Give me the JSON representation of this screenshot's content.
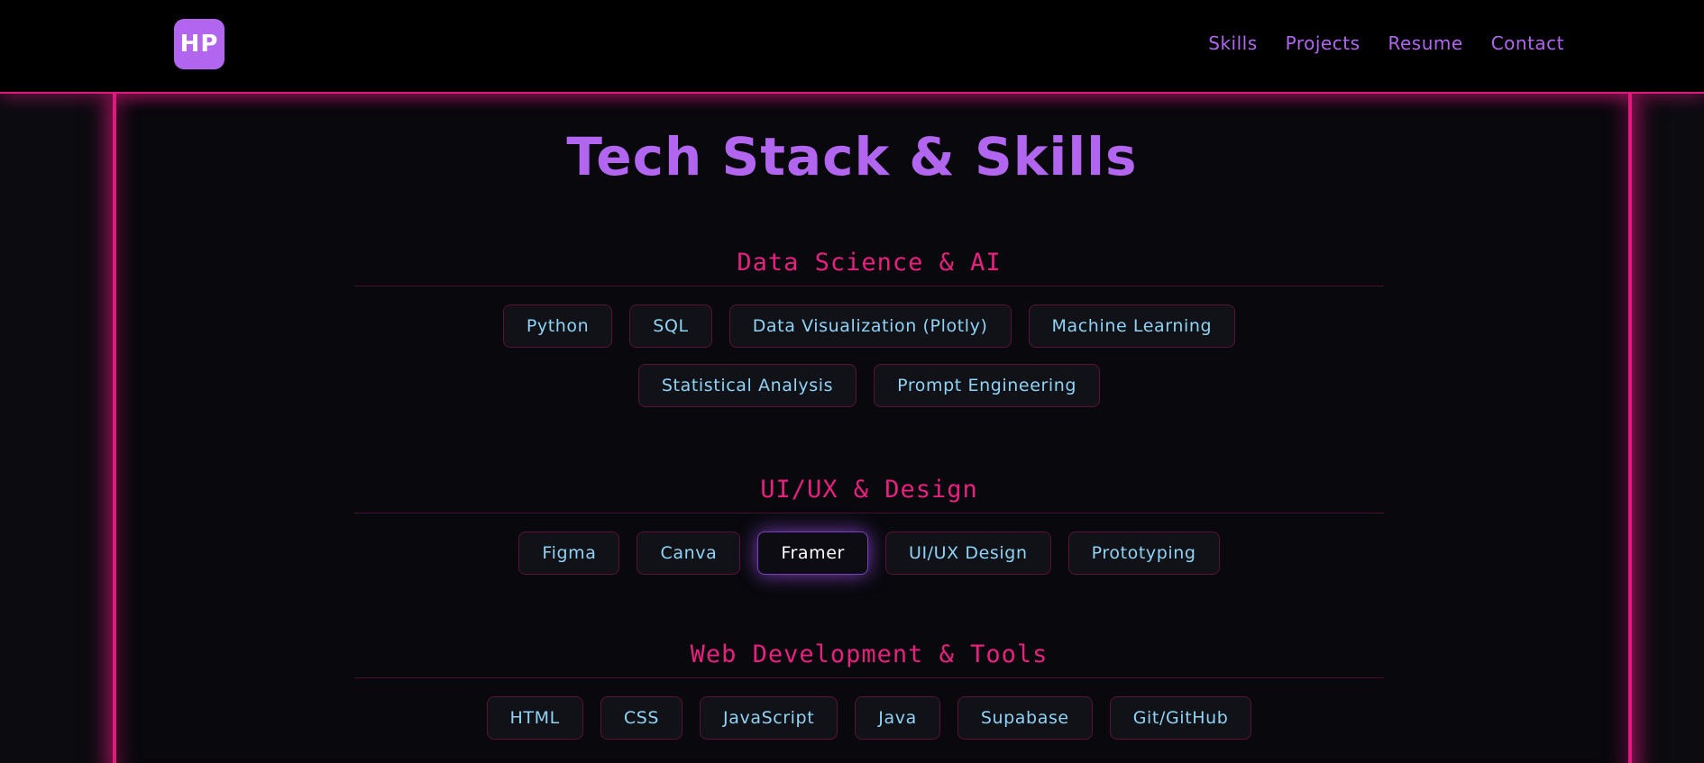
{
  "navbar": {
    "logo_text": "HP",
    "links": [
      "Skills",
      "Projects",
      "Resume",
      "Contact"
    ]
  },
  "main": {
    "title": "Tech Stack & Skills",
    "categories": [
      {
        "heading": "Data Science & AI",
        "rows": [
          [
            "Python",
            "SQL",
            "Data Visualization (Plotly)",
            "Machine Learning"
          ],
          [
            "Statistical Analysis",
            "Prompt Engineering"
          ]
        ]
      },
      {
        "heading": "UI/UX & Design",
        "rows": [
          [
            "Figma",
            "Canva",
            "Framer",
            "UI/UX Design",
            "Prototyping"
          ]
        ]
      },
      {
        "heading": "Web Development & Tools",
        "rows": [
          [
            "HTML",
            "CSS",
            "JavaScript",
            "Java",
            "Supabase",
            "Git/GitHub"
          ]
        ]
      }
    ]
  },
  "colors": {
    "accent_pink": "#e0197f",
    "accent_purple": "#b266f0",
    "chip_text": "#8fd3f5",
    "background": "#07070b"
  },
  "state": {
    "highlighted_chip": "Framer"
  }
}
